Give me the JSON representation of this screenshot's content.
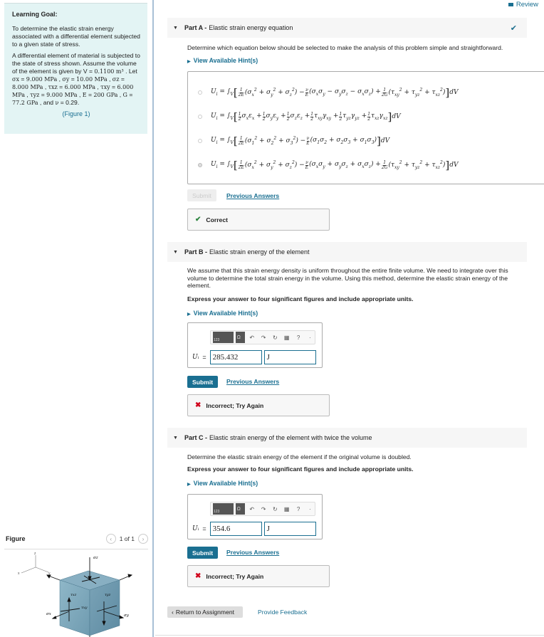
{
  "learning_goal": {
    "title": "Learning Goal:",
    "para1": "To determine the elastic strain energy associated with a differential element subjected to a given state of stress.",
    "para2_prefix": "A differential element of material is subjected to the state of stress shown. Assume the volume of the element is given by V =",
    "volume": "0.1100 m³",
    "sigma_x": "9.000 MPa",
    "sigma_y": "10.00 MPa",
    "sigma_z": "8.000 MPa",
    "tau_xz": "6.000 MPa",
    "tau_xy": "6.000 MPa",
    "tau_yz": "9.000 MPa",
    "E": "200 GPa",
    "G": "77.2 GPa",
    "nu": "0.29",
    "figure_link": "(Figure 1)"
  },
  "figure": {
    "title": "Figure",
    "pager": "1 of 1",
    "labels": [
      "z",
      "x",
      "y",
      "σz",
      "τxz",
      "τyz",
      "σx",
      "τxy",
      "σy"
    ]
  },
  "header": {
    "review_label": "Review"
  },
  "partA": {
    "label": "Part A -",
    "title": "Elastic strain energy equation",
    "status": "correct",
    "prompt": "Determine which equation below should be selected to make the analysis of this problem simple and straightforward.",
    "hint_label": "View Available Hint(s)",
    "options": [
      {
        "text": "Uᵢ = ∫V[1/2E(σx² + σy² + σz²) − ν/E(σxσy − σyσz − σxσz) + 1/2G(τxy² + τyz² + τxz²)]dV",
        "selected": false
      },
      {
        "text": "Uᵢ = ∫V[½σxεx + ½σyεy + ½σzεz + ½τxyγxy + ½τyzγyz + ½τxzγxz]dV",
        "selected": false
      },
      {
        "text": "Uᵢ = ∫V[1/2E(σ1² + σ2² + σ3²) − ν/E(σ1σ2 + σ2σ3 + σ1σ3)]dV",
        "selected": false
      },
      {
        "text": "Uᵢ = ∫V[1/2E(σx² + σy² + σz²) − ν/E(σxσy + σyσz + σxσz) + 1/2G(τxy² + τyz² + τxz²)]dV",
        "selected": true
      }
    ],
    "submit_label": "Submit",
    "previous_label": "Previous Answers",
    "feedback": "Correct"
  },
  "partB": {
    "label": "Part B -",
    "title": "Elastic strain energy of the element",
    "prompt": "We assume that this strain energy density is uniform throughout the entire finite volume. We need to integrate over this volume to determine the total strain energy in the volume. Using this method, determine the elastic strain energy of the element.",
    "instruction": "Express your answer to four significant figures and include appropriate units.",
    "hint_label": "View Available Hint(s)",
    "answer_label": "Uᵢ",
    "value": "285.432",
    "unit": "J",
    "submit_label": "Submit",
    "previous_label": "Previous Answers",
    "feedback": "Incorrect; Try Again"
  },
  "partC": {
    "label": "Part C -",
    "title": "Elastic strain energy of the element with twice the volume",
    "prompt": "Determine the elastic strain energy of the element if the original volume is doubled.",
    "instruction": "Express your answer to four significant figures and include appropriate units.",
    "hint_label": "View Available Hint(s)",
    "answer_label": "Uᵢ",
    "value": "354.6",
    "unit": "J",
    "submit_label": "Submit",
    "previous_label": "Previous Answers",
    "feedback": "Incorrect; Try Again"
  },
  "toolbar": {
    "templates_label": "123",
    "symbols_label": "Ω"
  },
  "footer": {
    "return_label": "Return to Assignment",
    "feedback_label": "Provide Feedback"
  },
  "colors": {
    "accent": "#1a6f91",
    "goal_bg": "#e3f4f4",
    "correct": "#2e8540",
    "incorrect": "#d0021b"
  }
}
